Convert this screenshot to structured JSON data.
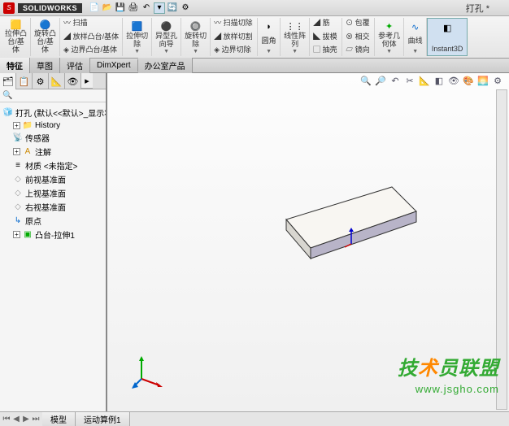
{
  "titlebar": {
    "brand": "SOLIDWORKS",
    "doc": "打孔 *"
  },
  "ribbon": {
    "r1a": "拉伸凸",
    "r1b": "台/基",
    "r1c": "体",
    "r2a": "旋转凸",
    "r2b": "台/基",
    "r2c": "体",
    "r3a": "扫描",
    "r3b": "放样凸台/基体",
    "r3c": "边界凸台/基体",
    "r4a": "拉伸切",
    "r4b": "除",
    "r5a": "异型孔",
    "r5b": "向导",
    "r6a": "旋转切",
    "r6b": "除",
    "r7a": "扫描切除",
    "r7b": "放样切割",
    "r7c": "边界切除",
    "r8a": "圆角",
    "r9a": "线性阵",
    "r9b": "列",
    "r10a": "筋",
    "r10b": "拔模",
    "r10c": "抽壳",
    "r11a": "包覆",
    "r11b": "相交",
    "r11c": "镜向",
    "r12a": "参考几",
    "r12b": "何体",
    "r13a": "曲线",
    "r14a": "Instant3D"
  },
  "tabs": {
    "t1": "特征",
    "t2": "草图",
    "t3": "评估",
    "t4": "DimXpert",
    "t5": "办公室产品"
  },
  "tree": {
    "root": "打孔 (默认<<默认>_显示状态",
    "history": "History",
    "sensors": "传感器",
    "annotations": "注解",
    "material": "材质 <未指定>",
    "front": "前视基准面",
    "top": "上视基准面",
    "right": "右视基准面",
    "origin": "原点",
    "feature1": "凸台-拉伸1"
  },
  "status": {
    "s1": "模型",
    "s2": "运动算例1"
  },
  "watermark": {
    "line1a": "技",
    "line1b": "术",
    "line1c": "员联盟",
    "line2": "www.jsgho.com"
  }
}
